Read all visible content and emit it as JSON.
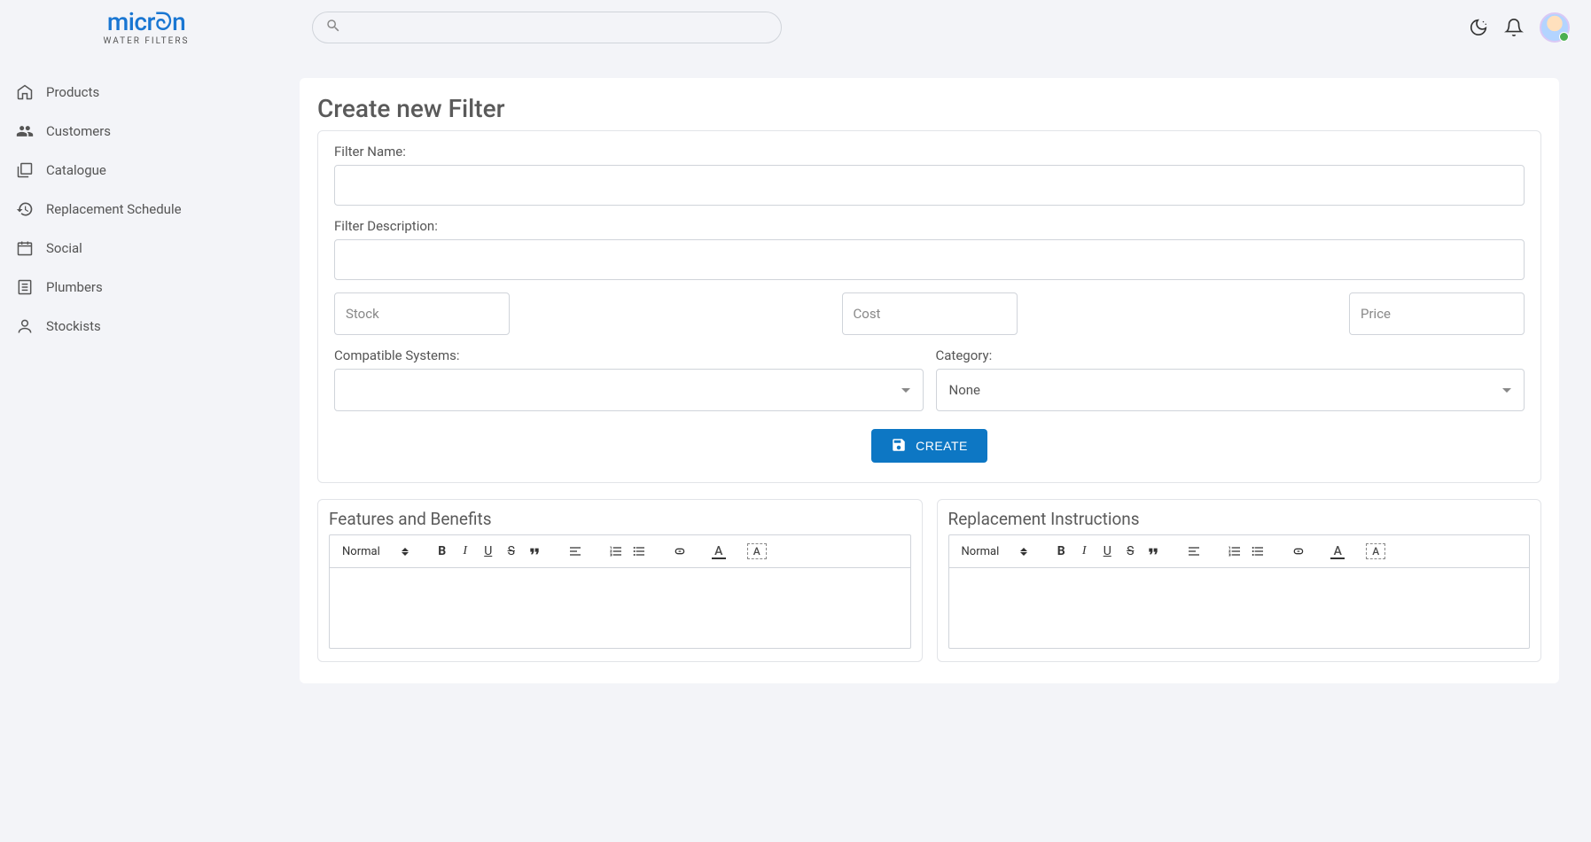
{
  "brand": {
    "main": "micrᘐn",
    "sub": "WATER FILTERS"
  },
  "header": {
    "search_placeholder": ""
  },
  "sidebar": {
    "items": [
      {
        "label": "Products",
        "icon": "home"
      },
      {
        "label": "Customers",
        "icon": "people"
      },
      {
        "label": "Catalogue",
        "icon": "library"
      },
      {
        "label": "Replacement Schedule",
        "icon": "history"
      },
      {
        "label": "Social",
        "icon": "calendar"
      },
      {
        "label": "Plumbers",
        "icon": "list"
      },
      {
        "label": "Stockists",
        "icon": "person"
      }
    ]
  },
  "page": {
    "title": "Create new Filter",
    "labels": {
      "name": "Filter Name:",
      "desc": "Filter Description:",
      "stock": "Stock",
      "cost": "Cost",
      "price": "Price",
      "compat": "Compatible Systems:",
      "category": "Category:"
    },
    "values": {
      "name": "",
      "desc": "",
      "stock": "",
      "cost": "",
      "price": "",
      "compat": "",
      "category": "None"
    },
    "create_button": "CREATE"
  },
  "editors": {
    "features": {
      "title": "Features and Benefits",
      "heading": "Normal"
    },
    "replacement": {
      "title": "Replacement Instructions",
      "heading": "Normal"
    }
  }
}
